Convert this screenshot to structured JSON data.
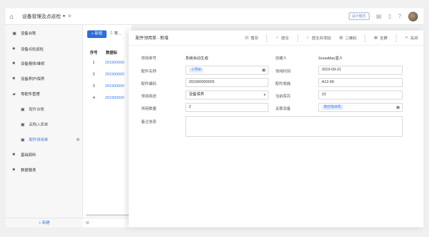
{
  "topbar": {
    "title": "设备管理及点巡检",
    "badge": "设计模式"
  },
  "sidebar": {
    "items": [
      {
        "label": "设备台账"
      },
      {
        "label": "设备点检巡检"
      },
      {
        "label": "设备报修/维修"
      },
      {
        "label": "设备养护/保养"
      },
      {
        "label": "零配件管理"
      },
      {
        "label": "配件台账"
      },
      {
        "label": "采购入库单"
      },
      {
        "label": "配件领用单"
      },
      {
        "label": "基础资料"
      },
      {
        "label": "数据报表"
      }
    ],
    "add_label": "+ 新建"
  },
  "list": {
    "new_label": "+ 新增",
    "secondary_label": "导...",
    "col_index": "序号",
    "col_code": "数据标",
    "rows": [
      {
        "n": "1",
        "code": "201900000"
      },
      {
        "n": "2",
        "code": "201900000"
      },
      {
        "n": "3",
        "code": "201900000"
      },
      {
        "n": "4",
        "code": "201900000"
      }
    ]
  },
  "modal": {
    "title": "配件领用单 - 新增",
    "toolbar": {
      "save_draft": "暂存",
      "submit": "提交",
      "submit_add": "提交并添加",
      "qrcode": "二维码",
      "fullscreen": "全屏",
      "close": "关闭"
    },
    "form": {
      "doc_no_label": "领用单号",
      "doc_no_value": "系统自动生成",
      "creator_label": "创建人",
      "creator_value": "SnowMan富人",
      "part_name_label": "配件名称",
      "part_name_tag": "小导轨",
      "date_label": "领用时间",
      "date_value": "2019-09-21",
      "part_code_label": "配件编码",
      "part_code_value": "201900000003",
      "spec_label": "配件规格",
      "spec_value": "A12-99",
      "purpose_label": "领用用途",
      "purpose_value": "设备保养",
      "stock_label": "当前库存",
      "stock_value": "23",
      "qty_label": "领用数量",
      "qty_value": "2",
      "device_label": "关联设备",
      "device_tag": "数控铣床机",
      "remark_label": "备注信息"
    }
  }
}
